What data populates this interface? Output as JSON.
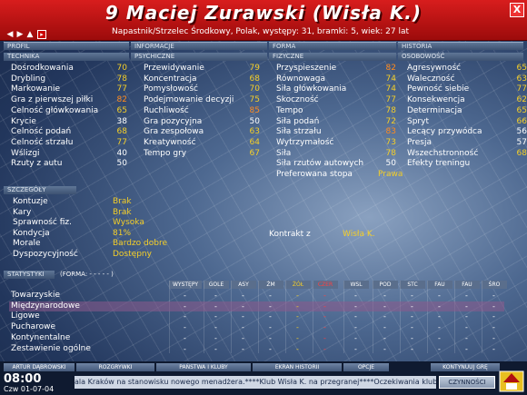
{
  "header": {
    "title": "9 Maciej Zurawski (Wisła K.)",
    "subtitle": "Napastnik/Strzelec Środkowy, Polak, występy: 31, bramki: 5, wiek: 27 lat",
    "close": "X"
  },
  "top_tabs": [
    "PROFIL",
    "INFORMACJE",
    "FORMA",
    "HISTORIA"
  ],
  "section_tabs": [
    "TECHNIKA",
    "PSYCHICZNE",
    "FIZYCZNE",
    "OSOBOWOŚĆ"
  ],
  "technika": [
    {
      "label": "Dośrodkowania",
      "value": "70"
    },
    {
      "label": "Drybling",
      "value": "78"
    },
    {
      "label": "Markowanie",
      "value": "77"
    },
    {
      "label": "Gra z pierwszej piłki",
      "value": "82"
    },
    {
      "label": "Celność główkowania",
      "value": "65"
    },
    {
      "label": "Krycie",
      "value": "38"
    },
    {
      "label": "Celność podań",
      "value": "68"
    },
    {
      "label": "Celność strzału",
      "value": "77"
    },
    {
      "label": "Wślizgi",
      "value": "40"
    },
    {
      "label": "Rzuty z autu",
      "value": "50"
    }
  ],
  "psychiczne": [
    {
      "label": "Przewidywanie",
      "value": "79"
    },
    {
      "label": "Koncentracja",
      "value": "68"
    },
    {
      "label": "Pomysłowość",
      "value": "70"
    },
    {
      "label": "Podejmowanie decyzji",
      "value": "75"
    },
    {
      "label": "Ruchliwość",
      "value": "85"
    },
    {
      "label": "Gra pozycyjna",
      "value": "50"
    },
    {
      "label": "Gra zespołowa",
      "value": "63"
    },
    {
      "label": "Kreatywność",
      "value": "64"
    },
    {
      "label": "Tempo gry",
      "value": "67"
    }
  ],
  "fizyczne": [
    {
      "label": "Przyspieszenie",
      "value": "82"
    },
    {
      "label": "Równowaga",
      "value": "74"
    },
    {
      "label": "Siła główkowania",
      "value": "74"
    },
    {
      "label": "Skoczność",
      "value": "77"
    },
    {
      "label": "Tempo",
      "value": "78"
    },
    {
      "label": "Siła podań",
      "value": "72"
    },
    {
      "label": "Siła strzału",
      "value": "83"
    },
    {
      "label": "Wytrzymałość",
      "value": "73"
    },
    {
      "label": "Siła",
      "value": "78"
    },
    {
      "label": "Siła rzutów autowych",
      "value": "50"
    },
    {
      "label": "Preferowana stopa",
      "value": "Prawa"
    }
  ],
  "osobowosc": [
    {
      "label": "Agresywność",
      "value": "65"
    },
    {
      "label": "Waleczność",
      "value": "63"
    },
    {
      "label": "Pewność siebie",
      "value": "77"
    },
    {
      "label": "Konsekwencja",
      "value": "62"
    },
    {
      "label": "Determinacja",
      "value": "65"
    },
    {
      "label": "Spryt",
      "value": "66"
    },
    {
      "label": "Lecący przywódca",
      "value": "56"
    },
    {
      "label": "Presja",
      "value": "57"
    },
    {
      "label": "Wszechstronność",
      "value": "68"
    },
    {
      "label": "Efekty treningu",
      "value": ""
    }
  ],
  "details": {
    "tab": "SZCZEGÓŁY",
    "rows": [
      {
        "label": "Kontuzje",
        "value": "Brak"
      },
      {
        "label": "Kary",
        "value": "Brak"
      },
      {
        "label": "Sprawność fiz.",
        "value": "Wysoka"
      },
      {
        "label": "Kondycja",
        "value": "81%"
      },
      {
        "label": "Morale",
        "value": "Bardzo dobre"
      },
      {
        "label": "Dyspozycyjność",
        "value": "Dostępny"
      }
    ],
    "contract_label": "Kontrakt z",
    "contract_value": "Wisła K."
  },
  "stats": {
    "tab": "STATYSTYKI",
    "form_label": "(FORMA: - - - - - )",
    "columns": [
      "WYSTĘPY",
      "GOLE",
      "ASY",
      "ŻM",
      "ŻÓŁ",
      "CZER",
      "WSL",
      "POD",
      "STC",
      "FAU",
      "FAU",
      "ŚRO"
    ],
    "rows": [
      "Towarzyskie",
      "Międzynarodowe",
      "Ligowe",
      "Pucharowe",
      "Kontynentalne",
      "Zestawienie ogólne"
    ]
  },
  "bottom_tabs": [
    "ARTUR DĄBROWSKI",
    "ROZGRYWKI",
    "PAŃSTWA I KLUBY",
    "EKRAN HISTORII",
    "OPCJE",
    "KONTYNUUJ GRĘ"
  ],
  "clock": "08:00",
  "date": "Czw 01-07-04",
  "ticker": "ala Kraków na stanowisku nowego menadżera.****Klub Wisła K. na przegranej****Oczekiwania klubu",
  "continue_button": "CZYNNOŚCI",
  "colors": {
    "header_red": "#c41414",
    "value_yellow": "#f5cf28",
    "value_orange": "#ff8a1e"
  }
}
